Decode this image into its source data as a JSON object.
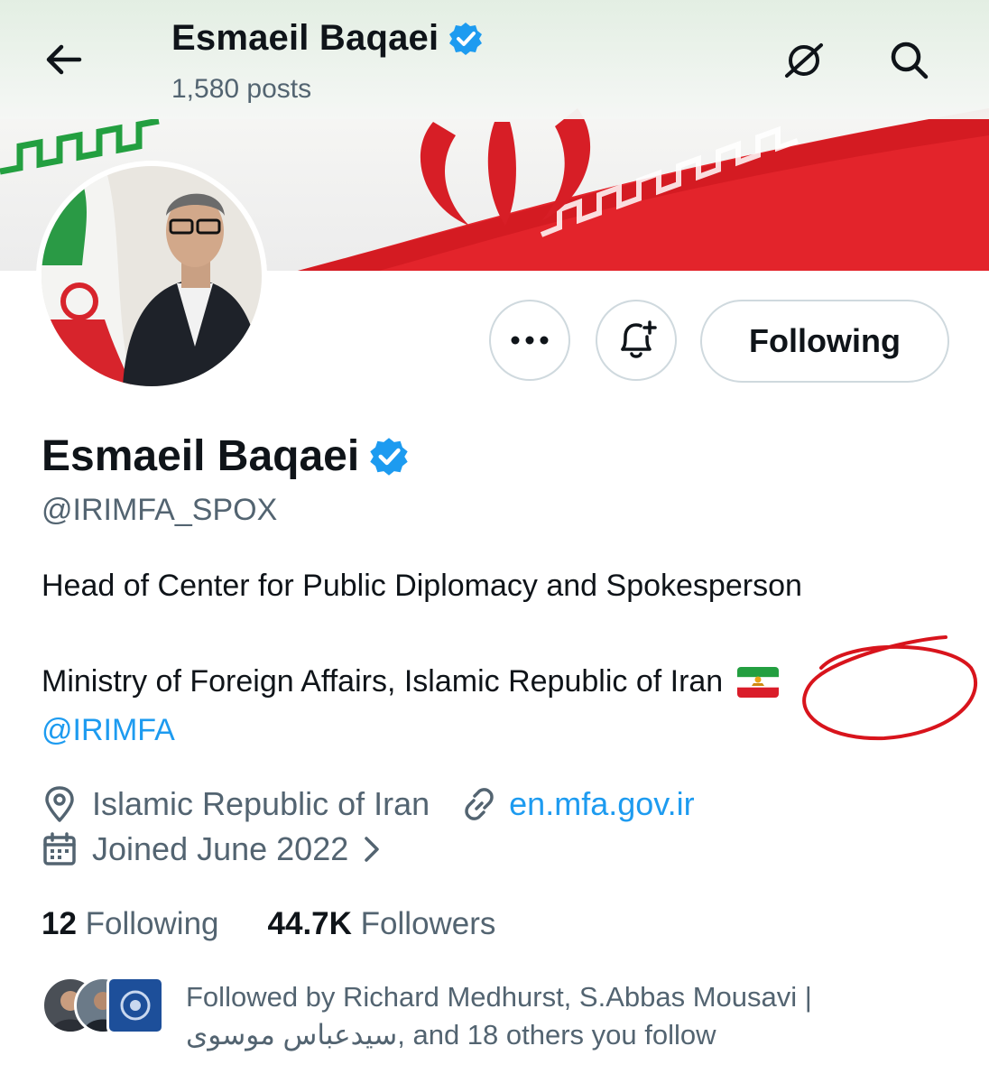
{
  "header": {
    "name": "Esmaeil Baqaei",
    "posts": "1,580 posts"
  },
  "actions": {
    "more_label": "•••",
    "following_label": "Following"
  },
  "profile": {
    "name": "Esmaeil Baqaei",
    "handle": "@IRIMFA_SPOX",
    "bio_line1": "Head of Center for Public Diplomacy and Spokesperson",
    "bio_line2": "Ministry of Foreign Affairs, Islamic Republic of Iran",
    "bio_mention": "@IRIMFA",
    "location": "Islamic Republic of Iran",
    "website": "en.mfa.gov.ir",
    "joined": "Joined June 2022"
  },
  "stats": {
    "following_count": "12",
    "following_label": "Following",
    "followers_count": "44.7K",
    "followers_label": "Followers"
  },
  "followed_by": {
    "line1": "Followed by Richard Medhurst, S.Abbas Mousavi |",
    "line2": "سیدعباس موسوی, and 18 others you follow"
  },
  "colors": {
    "accent_blue": "#1d9bf0",
    "secondary_text": "#536471",
    "flag_red": "#da1d2a",
    "flag_green": "#239f40",
    "annotation_red": "#d8141c"
  },
  "icons": [
    "back-arrow-icon",
    "grok-icon",
    "search-icon",
    "verified-badge-icon",
    "more-icon",
    "notification-bell-plus-icon",
    "location-pin-icon",
    "link-icon",
    "calendar-icon",
    "chevron-right-icon",
    "lion-and-sun-flag-icon"
  ]
}
